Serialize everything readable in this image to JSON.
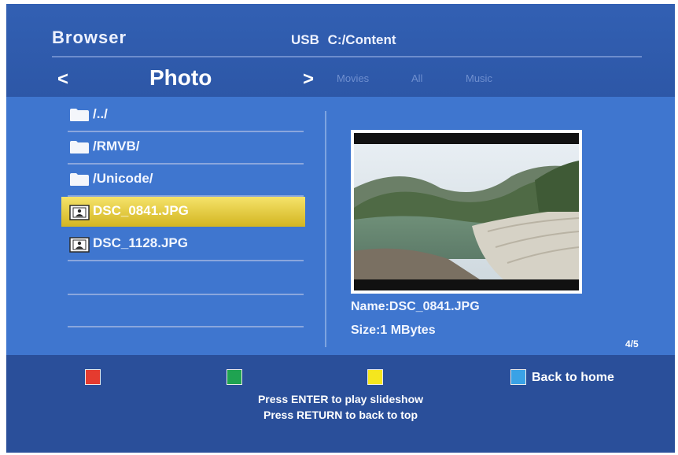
{
  "header": {
    "app_title": "Browser",
    "source_device": "USB",
    "source_path": "C:/Content"
  },
  "category_nav": {
    "prev_arrow": "<",
    "current": "Photo",
    "next_arrow": ">",
    "others": [
      "Movies",
      "All",
      "Music"
    ]
  },
  "file_list": {
    "items": [
      {
        "type": "folder",
        "name": "/../"
      },
      {
        "type": "folder",
        "name": "/RMVB/"
      },
      {
        "type": "folder",
        "name": "/Unicode/"
      },
      {
        "type": "photo",
        "name": "DSC_0841.JPG",
        "selected": true
      },
      {
        "type": "photo",
        "name": "DSC_1128.JPG"
      }
    ]
  },
  "preview": {
    "name_label": "Name:DSC_0841.JPG",
    "size_label": "Size:1 MBytes",
    "page_counter": "4/5"
  },
  "footer": {
    "keys": [
      {
        "color": "#e53b2f"
      },
      {
        "color": "#1fa351"
      },
      {
        "color": "#f5e61e"
      },
      {
        "color": "#3aa2e6",
        "label": "Back to home"
      }
    ],
    "hint_line1": "Press ENTER to play slideshow",
    "hint_line2": "Press RETURN to back to top"
  },
  "colors": {
    "background_top": "#3260b3",
    "panel": "#3f76cf",
    "selection": "#e2c63b"
  }
}
